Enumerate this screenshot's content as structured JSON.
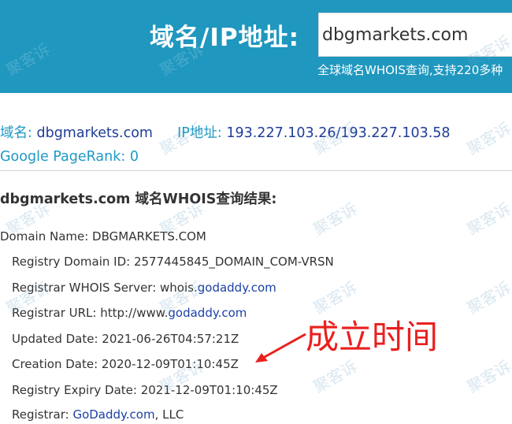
{
  "header": {
    "title": "域名/IP地址:",
    "search_value": "dbgmarkets.com",
    "note": "全球域名WHOIS查询,支持220多种"
  },
  "summary": {
    "domain_label": "域名:",
    "domain_value": "dbgmarkets.com",
    "ip_label": "IP地址:",
    "ip_value": "193.227.103.26/193.227.103.58",
    "pagerank_label": "Google PageRank: 0"
  },
  "result": {
    "title": "dbgmarkets.com 域名WHOIS查询结果:",
    "records": [
      {
        "prefix": "Domain Name: DBGMARKETS.COM",
        "link": "",
        "suffix": ""
      },
      {
        "prefix": "Registry Domain ID: 2577445845_DOMAIN_COM-VRSN",
        "link": "",
        "suffix": ""
      },
      {
        "prefix": "Registrar WHOIS Server: whois.",
        "link": "godaddy.com",
        "suffix": ""
      },
      {
        "prefix": "Registrar URL: http://www.",
        "link": "godaddy.com",
        "suffix": ""
      },
      {
        "prefix": "Updated Date: 2021-06-26T04:57:21Z",
        "link": "",
        "suffix": ""
      },
      {
        "prefix": "Creation Date: 2020-12-09T01:10:45Z",
        "link": "",
        "suffix": ""
      },
      {
        "prefix": "Registry Expiry Date: 2021-12-09T01:10:45Z",
        "link": "",
        "suffix": ""
      },
      {
        "prefix": "Registrar: ",
        "link": "GoDaddy.com",
        "suffix": ", LLC"
      }
    ]
  },
  "annotation": {
    "text": "成立时间",
    "color": "#e8201e"
  },
  "watermark": {
    "text": "聚客诉"
  },
  "colors": {
    "header_bg": "#1f97bf",
    "link": "#1a3fa8",
    "summary_label": "#1e9ac4"
  }
}
